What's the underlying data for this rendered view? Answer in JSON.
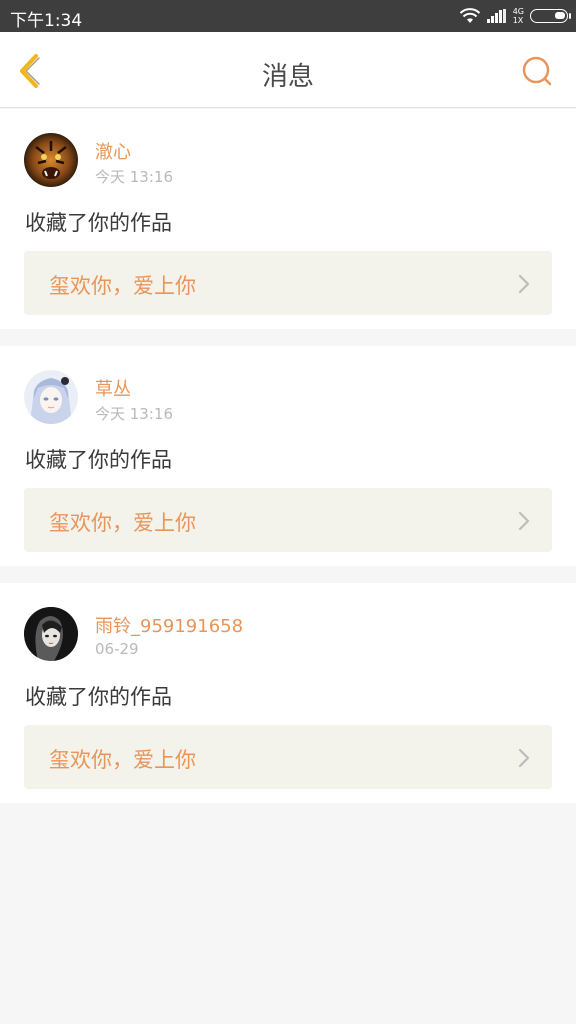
{
  "status_bar": {
    "time": "下午1:34",
    "network_top": "4G",
    "network_bottom": "1X",
    "icons": [
      "wifi-icon",
      "signal-icon",
      "signal-icon",
      "battery-icon"
    ]
  },
  "header": {
    "title": "消息",
    "back_icon": "chevron-left-icon",
    "search_icon": "search-icon",
    "accent_color": "#e8955a",
    "back_color": "#f2b51c"
  },
  "messages": [
    {
      "username": "澈心",
      "time": "今天 13:16",
      "action": "收藏了你的作品",
      "work_title": "玺欢你，爱上你",
      "avatar_icon": "tiger-avatar"
    },
    {
      "username": "草丛",
      "time": "今天 13:16",
      "action": "收藏了你的作品",
      "work_title": "玺欢你，爱上你",
      "avatar_icon": "anime-girl-avatar"
    },
    {
      "username": "雨铃_959191658",
      "time": "06-29",
      "action": "收藏了你的作品",
      "work_title": "玺欢你，爱上你",
      "avatar_icon": "dark-hair-girl-avatar"
    }
  ]
}
